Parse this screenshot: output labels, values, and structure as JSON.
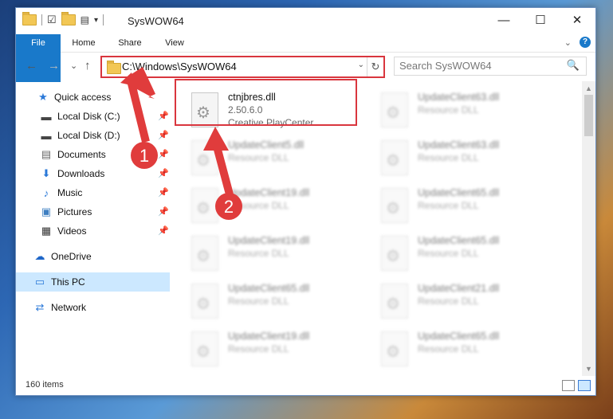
{
  "window": {
    "title": "SysWOW64",
    "qat_dropdown": "▾",
    "buttons": {
      "minimize": "—",
      "maximize": "☐",
      "close": "✕"
    }
  },
  "ribbon": {
    "tabs": [
      "File",
      "Home",
      "Share",
      "View"
    ],
    "expand": "⌄",
    "help": "?"
  },
  "nav": {
    "back": "←",
    "forward": "→",
    "recent": "⌄",
    "up": "↑",
    "address": "C:\\Windows\\SysWOW64",
    "address_drop": "⌄",
    "refresh": "↻",
    "search_placeholder": "Search SysWOW64",
    "search_icon": "🔍"
  },
  "sidebar": {
    "pin": "📌",
    "items": [
      {
        "label": "Quick access",
        "icon": "★",
        "color": "#2b79d8",
        "pinned": false
      },
      {
        "label": "Local Disk (C:)",
        "icon": "▬",
        "color": "#444",
        "pinned": true
      },
      {
        "label": "Local Disk (D:)",
        "icon": "▬",
        "color": "#444",
        "pinned": true
      },
      {
        "label": "Documents",
        "icon": "▤",
        "color": "#666",
        "pinned": true
      },
      {
        "label": "Downloads",
        "icon": "⬇",
        "color": "#2b79d8",
        "pinned": true
      },
      {
        "label": "Music",
        "icon": "♪",
        "color": "#2b79d8",
        "pinned": true
      },
      {
        "label": "Pictures",
        "icon": "▣",
        "color": "#3e7fc1",
        "pinned": true
      },
      {
        "label": "Videos",
        "icon": "▦",
        "color": "#333",
        "pinned": true
      },
      {
        "label": "OneDrive",
        "icon": "☁",
        "color": "#1e66c8",
        "pinned": false
      },
      {
        "label": "This PC",
        "icon": "▭",
        "color": "#2b79d8",
        "pinned": false
      },
      {
        "label": "Network",
        "icon": "⇄",
        "color": "#2b79d8",
        "pinned": false
      }
    ]
  },
  "files": [
    {
      "name": "ctnjbres.dll",
      "l2": "2.50.6.0",
      "l3": "Creative PlayCenter...",
      "blurred": false
    },
    {
      "name": "UpdateClient63.dll",
      "l2": "Resource DLL",
      "l3": "",
      "blurred": true
    },
    {
      "name": "UpdateClient5.dll",
      "l2": "Resource DLL",
      "l3": "",
      "blurred": true
    },
    {
      "name": "UpdateClient63.dll",
      "l2": "Resource DLL",
      "l3": "",
      "blurred": true
    },
    {
      "name": "UpdateClient19.dll",
      "l2": "Resource DLL",
      "l3": "",
      "blurred": true
    },
    {
      "name": "UpdateClient65.dll",
      "l2": "Resource DLL",
      "l3": "",
      "blurred": true
    },
    {
      "name": "UpdateClient19.dll",
      "l2": "Resource DLL",
      "l3": "",
      "blurred": true
    },
    {
      "name": "UpdateClient65.dll",
      "l2": "Resource DLL",
      "l3": "",
      "blurred": true
    },
    {
      "name": "UpdateClient65.dll",
      "l2": "Resource DLL",
      "l3": "",
      "blurred": true
    },
    {
      "name": "UpdateClient21.dll",
      "l2": "Resource DLL",
      "l3": "",
      "blurred": true
    },
    {
      "name": "UpdateClient19.dll",
      "l2": "Resource DLL",
      "l3": "",
      "blurred": true
    },
    {
      "name": "UpdateClient65.dll",
      "l2": "Resource DLL",
      "l3": "",
      "blurred": true
    }
  ],
  "status": {
    "count": "160 items"
  },
  "annotations": {
    "step1": "1",
    "step2": "2",
    "color": "#e03c3c"
  }
}
